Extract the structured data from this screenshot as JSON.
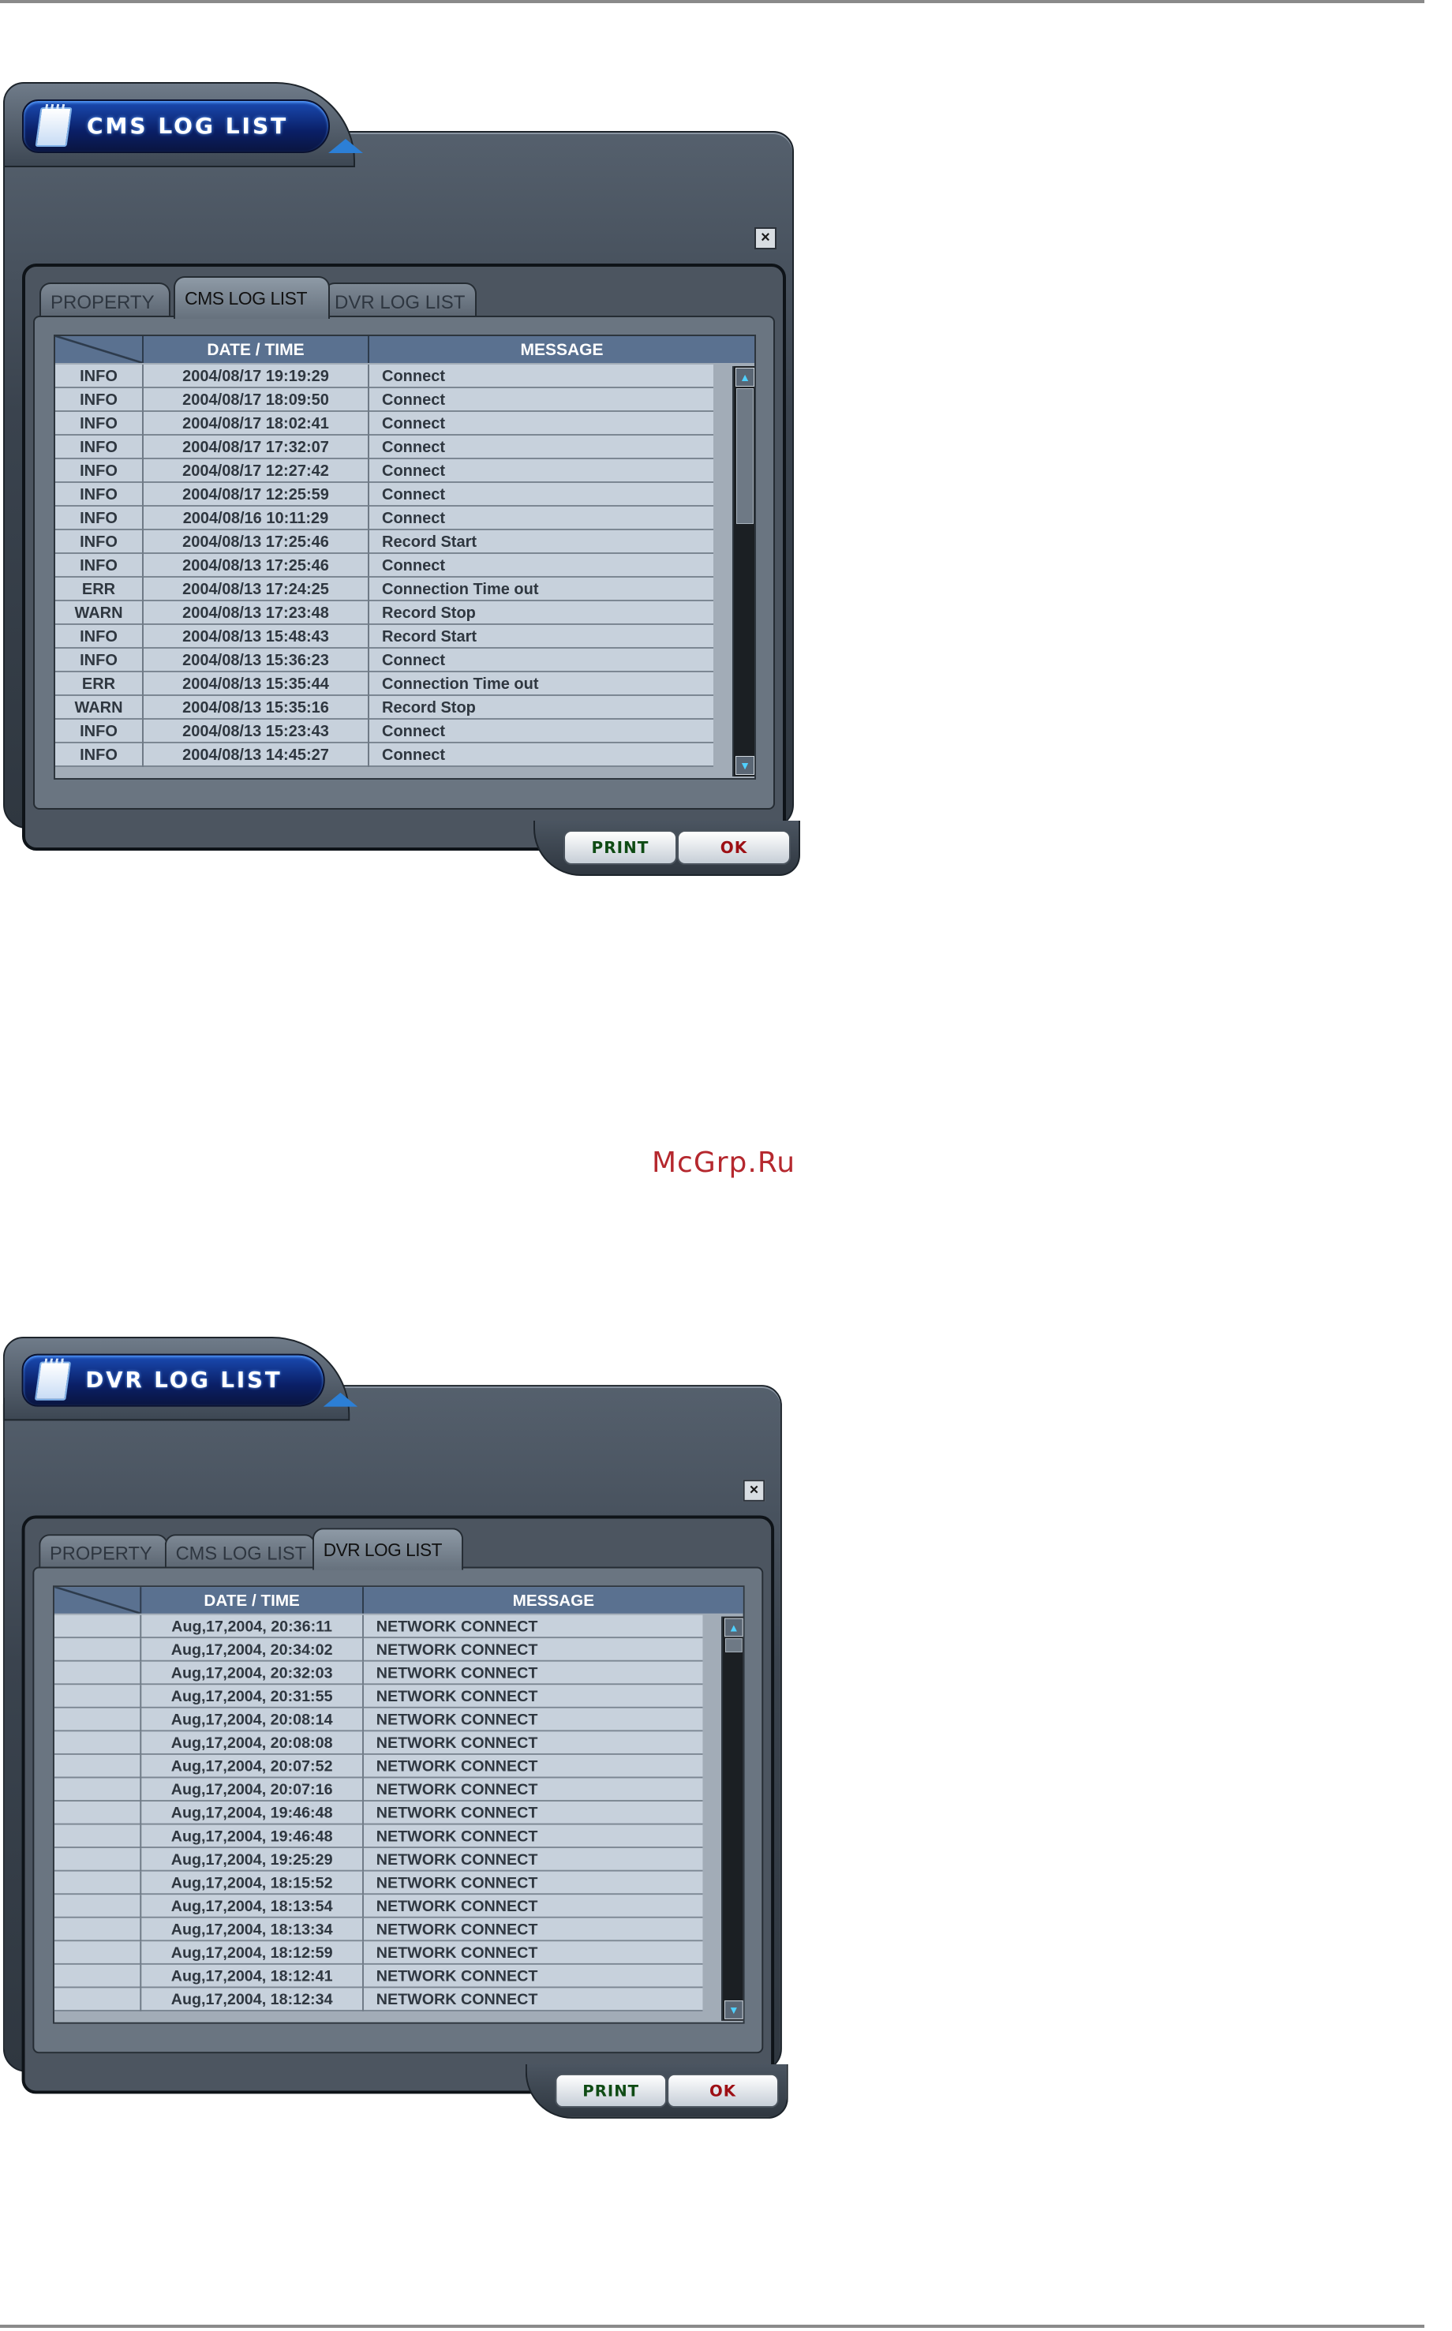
{
  "watermark": "McGrp.Ru",
  "dialogs": [
    {
      "title": "CMS LOG LIST",
      "close_label": "×",
      "tabs": [
        "PROPERTY",
        "CMS LOG LIST",
        "DVR LOG LIST"
      ],
      "active_tab": 1,
      "columns": [
        "",
        "DATE / TIME",
        "MESSAGE"
      ],
      "rows": [
        [
          "INFO",
          "2004/08/17 19:19:29",
          "Connect"
        ],
        [
          "INFO",
          "2004/08/17 18:09:50",
          "Connect"
        ],
        [
          "INFO",
          "2004/08/17 18:02:41",
          "Connect"
        ],
        [
          "INFO",
          "2004/08/17 17:32:07",
          "Connect"
        ],
        [
          "INFO",
          "2004/08/17 12:27:42",
          "Connect"
        ],
        [
          "INFO",
          "2004/08/17 12:25:59",
          "Connect"
        ],
        [
          "INFO",
          "2004/08/16 10:11:29",
          "Connect"
        ],
        [
          "INFO",
          "2004/08/13 17:25:46",
          "Record Start"
        ],
        [
          "INFO",
          "2004/08/13 17:25:46",
          "Connect"
        ],
        [
          "ERR",
          "2004/08/13 17:24:25",
          "Connection Time out"
        ],
        [
          "WARN",
          "2004/08/13 17:23:48",
          "Record Stop"
        ],
        [
          "INFO",
          "2004/08/13 15:48:43",
          "Record Start"
        ],
        [
          "INFO",
          "2004/08/13 15:36:23",
          "Connect"
        ],
        [
          "ERR",
          "2004/08/13 15:35:44",
          "Connection Time out"
        ],
        [
          "WARN",
          "2004/08/13 15:35:16",
          "Record Stop"
        ],
        [
          "INFO",
          "2004/08/13 15:23:43",
          "Connect"
        ],
        [
          "INFO",
          "2004/08/13 14:45:27",
          "Connect"
        ]
      ],
      "buttons": {
        "print": "PRINT",
        "ok": "OK"
      }
    },
    {
      "title": "DVR LOG LIST",
      "close_label": "×",
      "tabs": [
        "PROPERTY",
        "CMS LOG LIST",
        "DVR LOG LIST"
      ],
      "active_tab": 2,
      "columns": [
        "",
        "DATE / TIME",
        "MESSAGE"
      ],
      "rows": [
        [
          "",
          "Aug,17,2004, 20:36:11",
          "NETWORK CONNECT"
        ],
        [
          "",
          "Aug,17,2004, 20:34:02",
          "NETWORK CONNECT"
        ],
        [
          "",
          "Aug,17,2004, 20:32:03",
          "NETWORK CONNECT"
        ],
        [
          "",
          "Aug,17,2004, 20:31:55",
          "NETWORK CONNECT"
        ],
        [
          "",
          "Aug,17,2004, 20:08:14",
          "NETWORK CONNECT"
        ],
        [
          "",
          "Aug,17,2004, 20:08:08",
          "NETWORK CONNECT"
        ],
        [
          "",
          "Aug,17,2004, 20:07:52",
          "NETWORK CONNECT"
        ],
        [
          "",
          "Aug,17,2004, 20:07:16",
          "NETWORK CONNECT"
        ],
        [
          "",
          "Aug,17,2004, 19:46:48",
          "NETWORK CONNECT"
        ],
        [
          "",
          "Aug,17,2004, 19:46:48",
          "NETWORK CONNECT"
        ],
        [
          "",
          "Aug,17,2004, 19:25:29",
          "NETWORK CONNECT"
        ],
        [
          "",
          "Aug,17,2004, 18:15:52",
          "NETWORK CONNECT"
        ],
        [
          "",
          "Aug,17,2004, 18:13:54",
          "NETWORK CONNECT"
        ],
        [
          "",
          "Aug,17,2004, 18:13:34",
          "NETWORK CONNECT"
        ],
        [
          "",
          "Aug,17,2004, 18:12:59",
          "NETWORK CONNECT"
        ],
        [
          "",
          "Aug,17,2004, 18:12:41",
          "NETWORK CONNECT"
        ],
        [
          "",
          "Aug,17,2004, 18:12:34",
          "NETWORK CONNECT"
        ]
      ],
      "buttons": {
        "print": "PRINT",
        "ok": "OK"
      }
    }
  ]
}
